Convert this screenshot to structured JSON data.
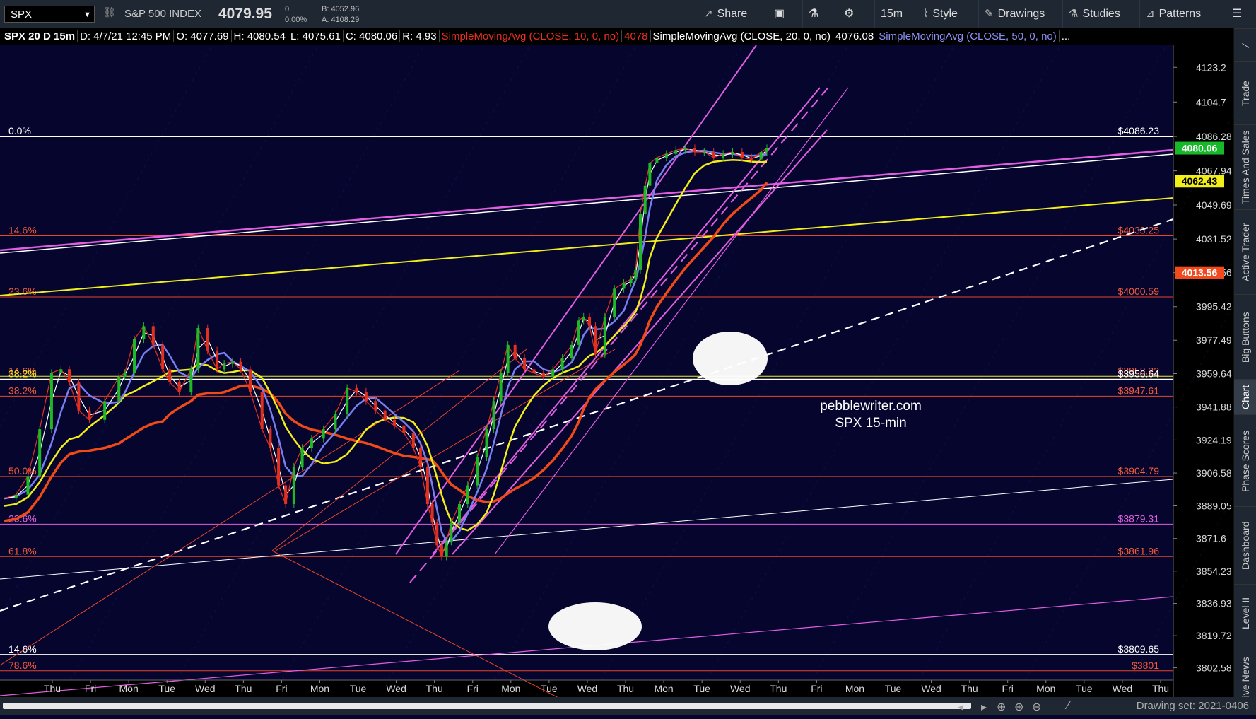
{
  "header": {
    "symbol": "SPX",
    "link_icon": "link-icon",
    "name": "S&P 500 INDEX",
    "last": "4079.95",
    "change": "0",
    "change_pct": "0.00%",
    "bid": "B: 4052.96",
    "ask": "A: 4108.29",
    "buttons": {
      "share": "Share",
      "interval": "15m",
      "style": "Style",
      "drawings": "Drawings",
      "studies": "Studies",
      "patterns": "Patterns"
    }
  },
  "studybar": {
    "title": "SPX 20 D 15m",
    "date": "D: 4/7/21 12:45 PM",
    "open": "O: 4077.69",
    "high": "H: 4080.54",
    "low": "L: 4075.61",
    "close": "C: 4080.06",
    "range": "R: 4.93",
    "sma10": "SimpleMovingAvg (CLOSE, 10, 0, no)",
    "sma10_val": "4078",
    "sma20": "SimpleMovingAvg (CLOSE, 20, 0, no)",
    "sma20_val": "4076.08",
    "sma50": "SimpleMovingAvg (CLOSE, 50, 0, no)",
    "more": "..."
  },
  "sidebar": [
    "Trade",
    "Times And Sales",
    "Active Trader",
    "Big Buttons",
    "Chart",
    "Phase Scores",
    "Dashboard",
    "Level II",
    "Live News"
  ],
  "footer": {
    "drawing_set": "Drawing set: 2021-0406"
  },
  "chart_data": {
    "type": "candlestick",
    "watermark": [
      "pebblewriter.com",
      "SPX 15-min"
    ],
    "ylim": [
      3796,
      4135
    ],
    "y_ticks": [
      4123.2,
      4104.7,
      4086.28,
      4067.94,
      4049.69,
      4031.52,
      4013.56,
      3995.42,
      3977.49,
      3959.64,
      3941.88,
      3924.19,
      3906.58,
      3889.05,
      3871.6,
      3854.23,
      3836.93,
      3819.72,
      3802.58
    ],
    "y_tick_labels": [
      "4123.2",
      "4104.7",
      "4086.28",
      "4067.94",
      "4049.69",
      "4031.52",
      "4013.56",
      "3995.42",
      "3977.49",
      "3959.64",
      "3941.88",
      "3924.19",
      "3906.58",
      "3889.05",
      "3871.6",
      "3854.23",
      "3836.93",
      "3819.72",
      "3802.58"
    ],
    "x_labels": [
      "Thu",
      "Fri",
      "Mon",
      "Tue",
      "Wed",
      "Thu",
      "Fri",
      "Mon",
      "Tue",
      "Wed",
      "Thu",
      "Fri",
      "Mon",
      "Tue",
      "Wed",
      "Thu",
      "Mon",
      "Tue",
      "Wed",
      "Thu",
      "Fri",
      "Mon",
      "Tue",
      "Wed",
      "Thu",
      "Fri",
      "Mon",
      "Tue",
      "Wed",
      "Thu"
    ],
    "price_badges": [
      {
        "label": "4080.06",
        "value": 4080.06,
        "bg": "#17b82a",
        "fg": "#ffffff"
      },
      {
        "label": "4062.43",
        "value": 4062.43,
        "bg": "#f2ee1a",
        "fg": "#000000"
      },
      {
        "label": "4013.56",
        "value": 4013.56,
        "bg": "#f24a1c",
        "fg": "#ffffff"
      }
    ],
    "fib_levels": [
      {
        "pct": "0.0%",
        "price": "$4086.23",
        "value": 4086.23,
        "color": "#ffffff",
        "pct_color": "#ffffff"
      },
      {
        "pct": "14.6%",
        "price": "$4033.25",
        "value": 4033.25,
        "color": "#e8452a",
        "pct_color": "#f25a3a"
      },
      {
        "pct": "23.6%",
        "price": "$4000.59",
        "value": 4000.59,
        "color": "#e8452a",
        "pct_color": "#f25a3a"
      },
      {
        "pct": "14.6%",
        "price": "$3958.22",
        "value": 3958.22,
        "color": "#f2ee1a",
        "pct_color": "#f25a3a"
      },
      {
        "pct": "38.2%",
        "price": "$3956.64",
        "value": 3956.64,
        "color": "#ffffff",
        "pct_color": "#f2ee1a"
      },
      {
        "pct": "38.2%",
        "price": "$3947.61",
        "value": 3947.61,
        "color": "#e8452a",
        "pct_color": "#f25a3a"
      },
      {
        "pct": "50.0%",
        "price": "$3904.79",
        "value": 3904.79,
        "color": "#e8452a",
        "pct_color": "#f25a3a"
      },
      {
        "pct": "23.6%",
        "price": "$3879.31",
        "value": 3879.31,
        "color": "#e25ee0",
        "pct_color": "#e25ee0"
      },
      {
        "pct": "61.8%",
        "price": "$3861.96",
        "value": 3861.96,
        "color": "#e8452a",
        "pct_color": "#f25a3a"
      },
      {
        "pct": "14.6%",
        "price": "$3809.65",
        "value": 3809.65,
        "color": "#ffffff",
        "pct_color": "#ffffff"
      },
      {
        "pct": "78.6%",
        "price": "$3801",
        "value": 3801,
        "color": "#e8452a",
        "pct_color": "#f25a3a"
      }
    ],
    "colors": {
      "bg": "#05052e",
      "up": "#1fb826",
      "down": "#e23020",
      "sma10": "#e83020",
      "sma20": "#ffffff",
      "sma50": "#7a7ff0",
      "sma100": "#f2ee1a",
      "sma200": "#f04a18",
      "channel": "#e25ee0"
    },
    "price_path": [
      [
        0,
        3893
      ],
      [
        10,
        3895
      ],
      [
        20,
        3905
      ],
      [
        30,
        3930
      ],
      [
        40,
        3960
      ],
      [
        48,
        3962
      ],
      [
        55,
        3955
      ],
      [
        63,
        3940
      ],
      [
        72,
        3935
      ],
      [
        85,
        3945
      ],
      [
        97,
        3958
      ],
      [
        102,
        3960
      ],
      [
        110,
        3978
      ],
      [
        118,
        3985
      ],
      [
        126,
        3975
      ],
      [
        134,
        3962
      ],
      [
        140,
        3955
      ],
      [
        148,
        3950
      ],
      [
        158,
        3962
      ],
      [
        164,
        3984
      ],
      [
        172,
        3972
      ],
      [
        180,
        3962
      ],
      [
        186,
        3965
      ],
      [
        193,
        3966
      ],
      [
        200,
        3962
      ],
      [
        208,
        3950
      ],
      [
        218,
        3930
      ],
      [
        225,
        3920
      ],
      [
        232,
        3900
      ],
      [
        238,
        3890
      ],
      [
        245,
        3910
      ],
      [
        252,
        3920
      ],
      [
        260,
        3925
      ],
      [
        270,
        3930
      ],
      [
        280,
        3938
      ],
      [
        290,
        3952
      ],
      [
        298,
        3950
      ],
      [
        306,
        3945
      ],
      [
        314,
        3940
      ],
      [
        322,
        3935
      ],
      [
        330,
        3932
      ],
      [
        338,
        3928
      ],
      [
        346,
        3920
      ],
      [
        352,
        3910
      ],
      [
        358,
        3890
      ],
      [
        362,
        3880
      ],
      [
        366,
        3868
      ],
      [
        370,
        3862
      ],
      [
        374,
        3870
      ],
      [
        378,
        3880
      ],
      [
        385,
        3890
      ],
      [
        392,
        3900
      ],
      [
        400,
        3915
      ],
      [
        408,
        3930
      ],
      [
        414,
        3945
      ],
      [
        420,
        3960
      ],
      [
        426,
        3975
      ],
      [
        432,
        3968
      ],
      [
        440,
        3962
      ],
      [
        448,
        3960
      ],
      [
        456,
        3958
      ],
      [
        464,
        3962
      ],
      [
        472,
        3968
      ],
      [
        480,
        3975
      ],
      [
        486,
        3988
      ],
      [
        490,
        3990
      ],
      [
        495,
        3985
      ],
      [
        500,
        3970
      ],
      [
        508,
        3990
      ],
      [
        516,
        4005
      ],
      [
        524,
        4008
      ],
      [
        530,
        4010
      ],
      [
        534,
        4015
      ],
      [
        538,
        4045
      ],
      [
        542,
        4060
      ],
      [
        546,
        4072
      ],
      [
        552,
        4075
      ],
      [
        560,
        4077
      ],
      [
        568,
        4079
      ],
      [
        576,
        4080
      ],
      [
        584,
        4078
      ],
      [
        592,
        4078
      ],
      [
        600,
        4075
      ],
      [
        608,
        4077
      ],
      [
        616,
        4078
      ],
      [
        624,
        4075
      ],
      [
        632,
        4074
      ],
      [
        640,
        4078
      ],
      [
        645,
        4080
      ]
    ]
  }
}
